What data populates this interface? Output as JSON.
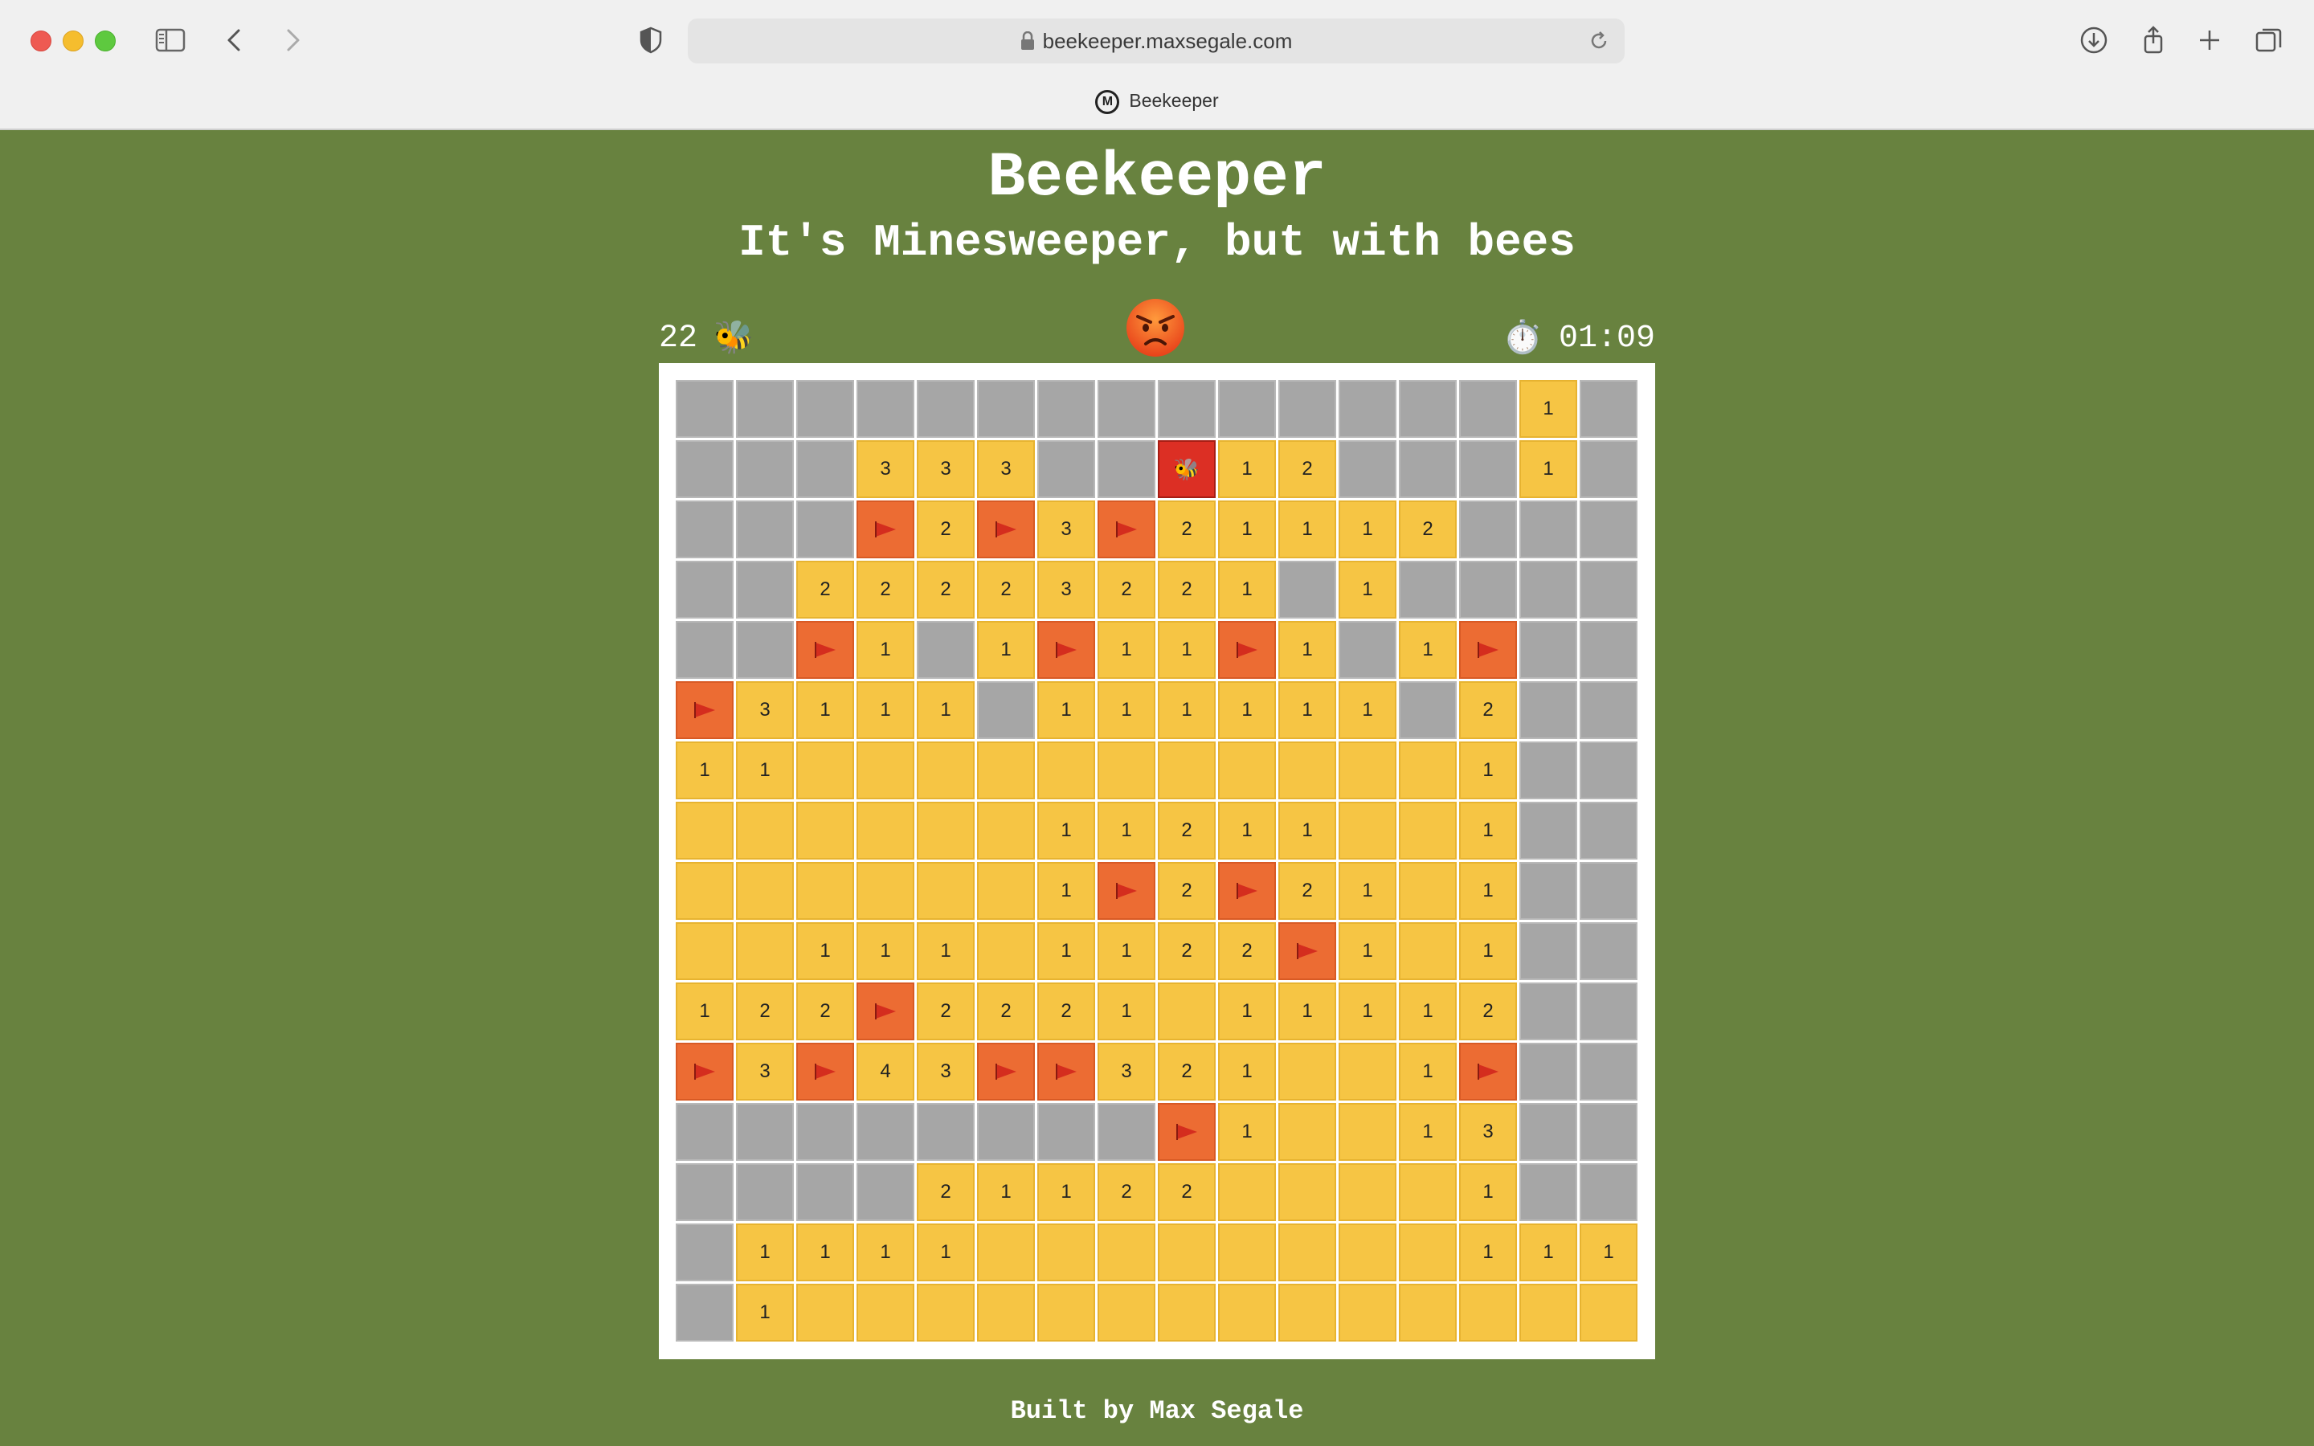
{
  "browser": {
    "url": "beekeeper.maxsegale.com",
    "tab_title": "Beekeeper",
    "favicon_letter": "M"
  },
  "page": {
    "title": "Beekeeper",
    "subtitle": "It's Minesweeper, but with bees",
    "footer": "Built by Max Segale"
  },
  "status": {
    "bee_count": "22",
    "bee_icon": "🐝",
    "face": "angry-face",
    "timer_icon": "⏱️",
    "timer": "01:09"
  },
  "colors": {
    "background": "#68823f",
    "hidden_cell": "#a6a6a6",
    "open_cell": "#f6c544",
    "flag_cell": "#ec6c33",
    "bee_cell": "#dc2f24",
    "flag": "#d42d1e"
  },
  "legend": {
    "#": "hidden",
    ".": "open-empty",
    "F": "flag",
    "B": "bee",
    "1-8": "open-number"
  },
  "board": [
    "##############1#",
    "###333##B12###1#",
    "###F2F3F21112###",
    "##22223221#1####",
    "##F1#1F11F1#1F##",
    "F3111#111111#2##",
    "11...........1##",
    "......11211..1##",
    "......1F2F21.1##",
    "..111.1122F1.1##",
    "122F2221.11112##",
    "F3F43FF321..1F##",
    "########F1..13##",
    "####21122l...1##",
    "#1111........111",
    "#1.............."
  ]
}
